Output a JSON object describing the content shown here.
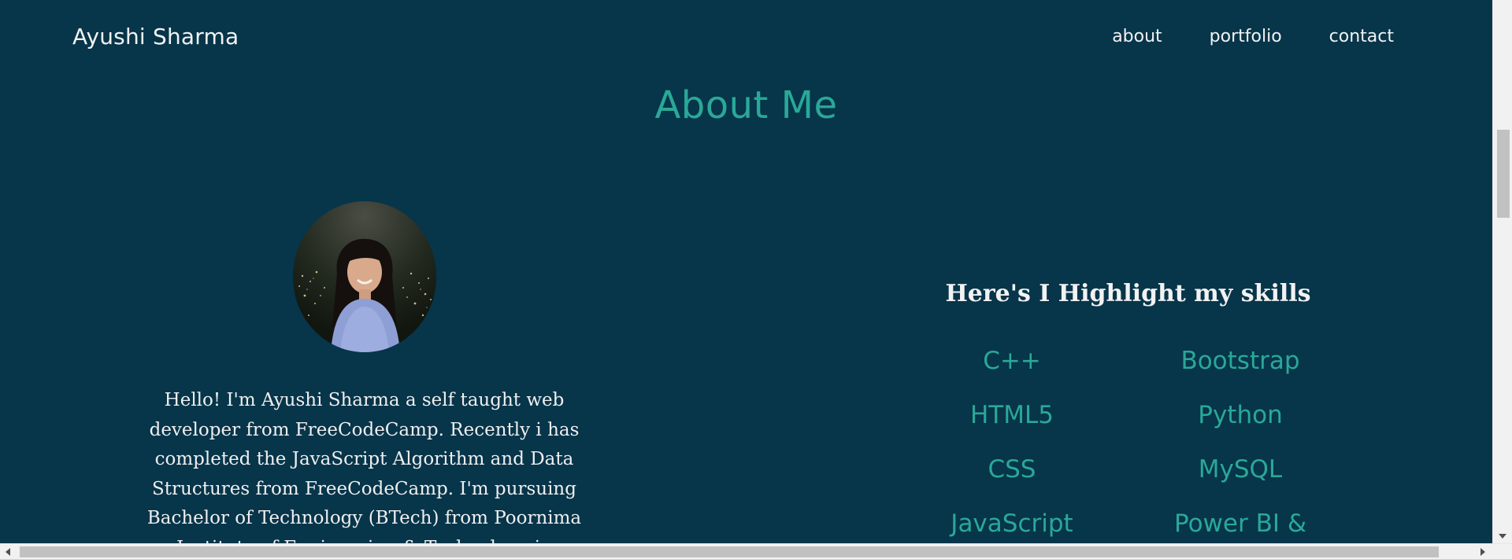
{
  "header": {
    "brand": "Ayushi Sharma",
    "nav": [
      {
        "label": "about"
      },
      {
        "label": "portfolio"
      },
      {
        "label": "contact"
      }
    ]
  },
  "about": {
    "title": "About Me",
    "bio": "Hello! I'm Ayushi Sharma a self taught web developer from FreeCodeCamp. Recently i has completed the JavaScript Algorithm and Data Structures from FreeCodeCamp. I'm pursuing Bachelor of Technology (BTech) from Poornima Institute of Engineering & Technology in"
  },
  "skills": {
    "heading": "Here's I Highlight my skills",
    "items": [
      "C++",
      "Bootstrap",
      "HTML5",
      "Python",
      "CSS",
      "MySQL",
      "JavaScript",
      "Power BI &"
    ]
  },
  "colors": {
    "background": "#07354a",
    "accent": "#2aa898",
    "text": "#f2f2f2"
  }
}
